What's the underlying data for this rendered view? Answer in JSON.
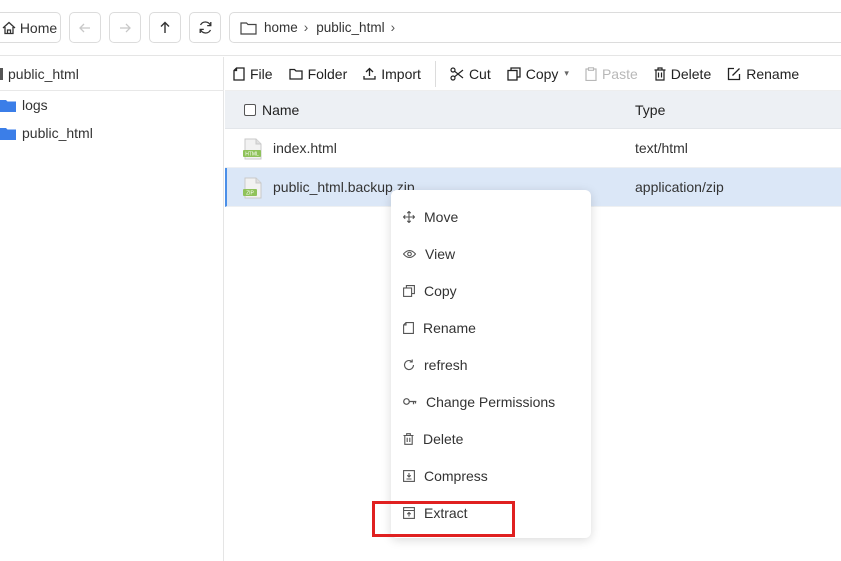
{
  "topbar": {
    "home_label": "Home",
    "breadcrumb": [
      "home",
      "public_html"
    ]
  },
  "tree": {
    "root_label": "public_html",
    "items": [
      {
        "label": "logs"
      },
      {
        "label": "public_html"
      }
    ]
  },
  "toolbar": {
    "file_label": "File",
    "folder_label": "Folder",
    "import_label": "Import",
    "cut_label": "Cut",
    "copy_label": "Copy",
    "paste_label": "Paste",
    "delete_label": "Delete",
    "rename_label": "Rename"
  },
  "table": {
    "columns": [
      "Name",
      "Type"
    ],
    "rows": [
      {
        "name": "index.html",
        "type": "text/html",
        "icon": "html-file-icon"
      },
      {
        "name": "public_html.backup.zip",
        "type": "application/zip",
        "icon": "zip-file-icon"
      }
    ]
  },
  "context_menu": {
    "items": [
      {
        "label": "Move",
        "icon": "move-icon"
      },
      {
        "label": "View",
        "icon": "eye-icon"
      },
      {
        "label": "Copy",
        "icon": "copy-icon"
      },
      {
        "label": "Rename",
        "icon": "rename-icon"
      },
      {
        "label": "refresh",
        "icon": "refresh-icon"
      },
      {
        "label": "Change Permissions",
        "icon": "key-icon"
      },
      {
        "label": "Delete",
        "icon": "trash-icon"
      },
      {
        "label": "Compress",
        "icon": "compress-icon"
      },
      {
        "label": "Extract",
        "icon": "extract-icon"
      }
    ]
  },
  "colors": {
    "accent": "#4b8fe8",
    "folder": "#3b7ee8",
    "selected_row": "#dbe7f7",
    "highlight_box": "#e02020"
  }
}
